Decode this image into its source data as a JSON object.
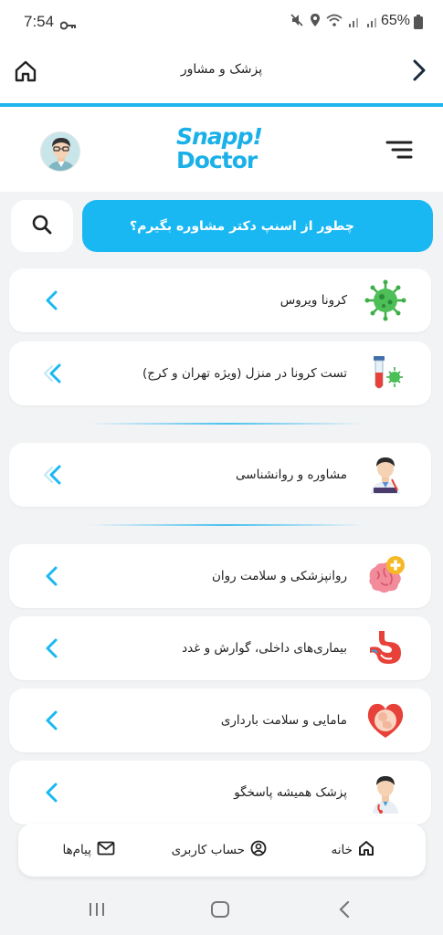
{
  "status_bar": {
    "time": "7:54",
    "battery": "65%",
    "icons": [
      "key-icon",
      "mute-icon",
      "location-icon",
      "wifi-icon",
      "signal-icon",
      "signal-icon",
      "battery-icon"
    ]
  },
  "topbar": {
    "title": "پزشک و مشاور",
    "home_icon": "home-icon",
    "back_icon": "chevron-right-icon"
  },
  "header": {
    "logo_line1": "Snapp!",
    "logo_line2": "Doctor",
    "avatar_icon": "doctor-avatar",
    "menu_icon": "menu-icon"
  },
  "search": {
    "icon": "search-icon",
    "how_label": "چطور از اسنپ دکتر مشاوره بگیرم؟"
  },
  "categories": [
    {
      "label": "کرونا ویروس",
      "icon": "virus-icon"
    },
    {
      "label": "تست کرونا در منزل (ویژه تهران و کرج)",
      "icon": "test-tube-icon"
    },
    {
      "label": "مشاوره و روانشناسی",
      "icon": "counselor-icon"
    },
    {
      "label": "روانپزشکی و سلامت روان",
      "icon": "brain-icon"
    },
    {
      "label": "بیماری‌های داخلی، گوارش و غدد",
      "icon": "stomach-icon"
    },
    {
      "label": "مامایی و سلامت بارداری",
      "icon": "pregnancy-icon"
    },
    {
      "label": "پزشک همیشه پاسخگو",
      "icon": "doctor-icon"
    }
  ],
  "bottom_nav": {
    "home": "خانه",
    "account": "حساب کاربری",
    "messages": "پیام‌ها"
  },
  "colors": {
    "accent": "#1ab8f3",
    "background": "#f1f3f5"
  }
}
